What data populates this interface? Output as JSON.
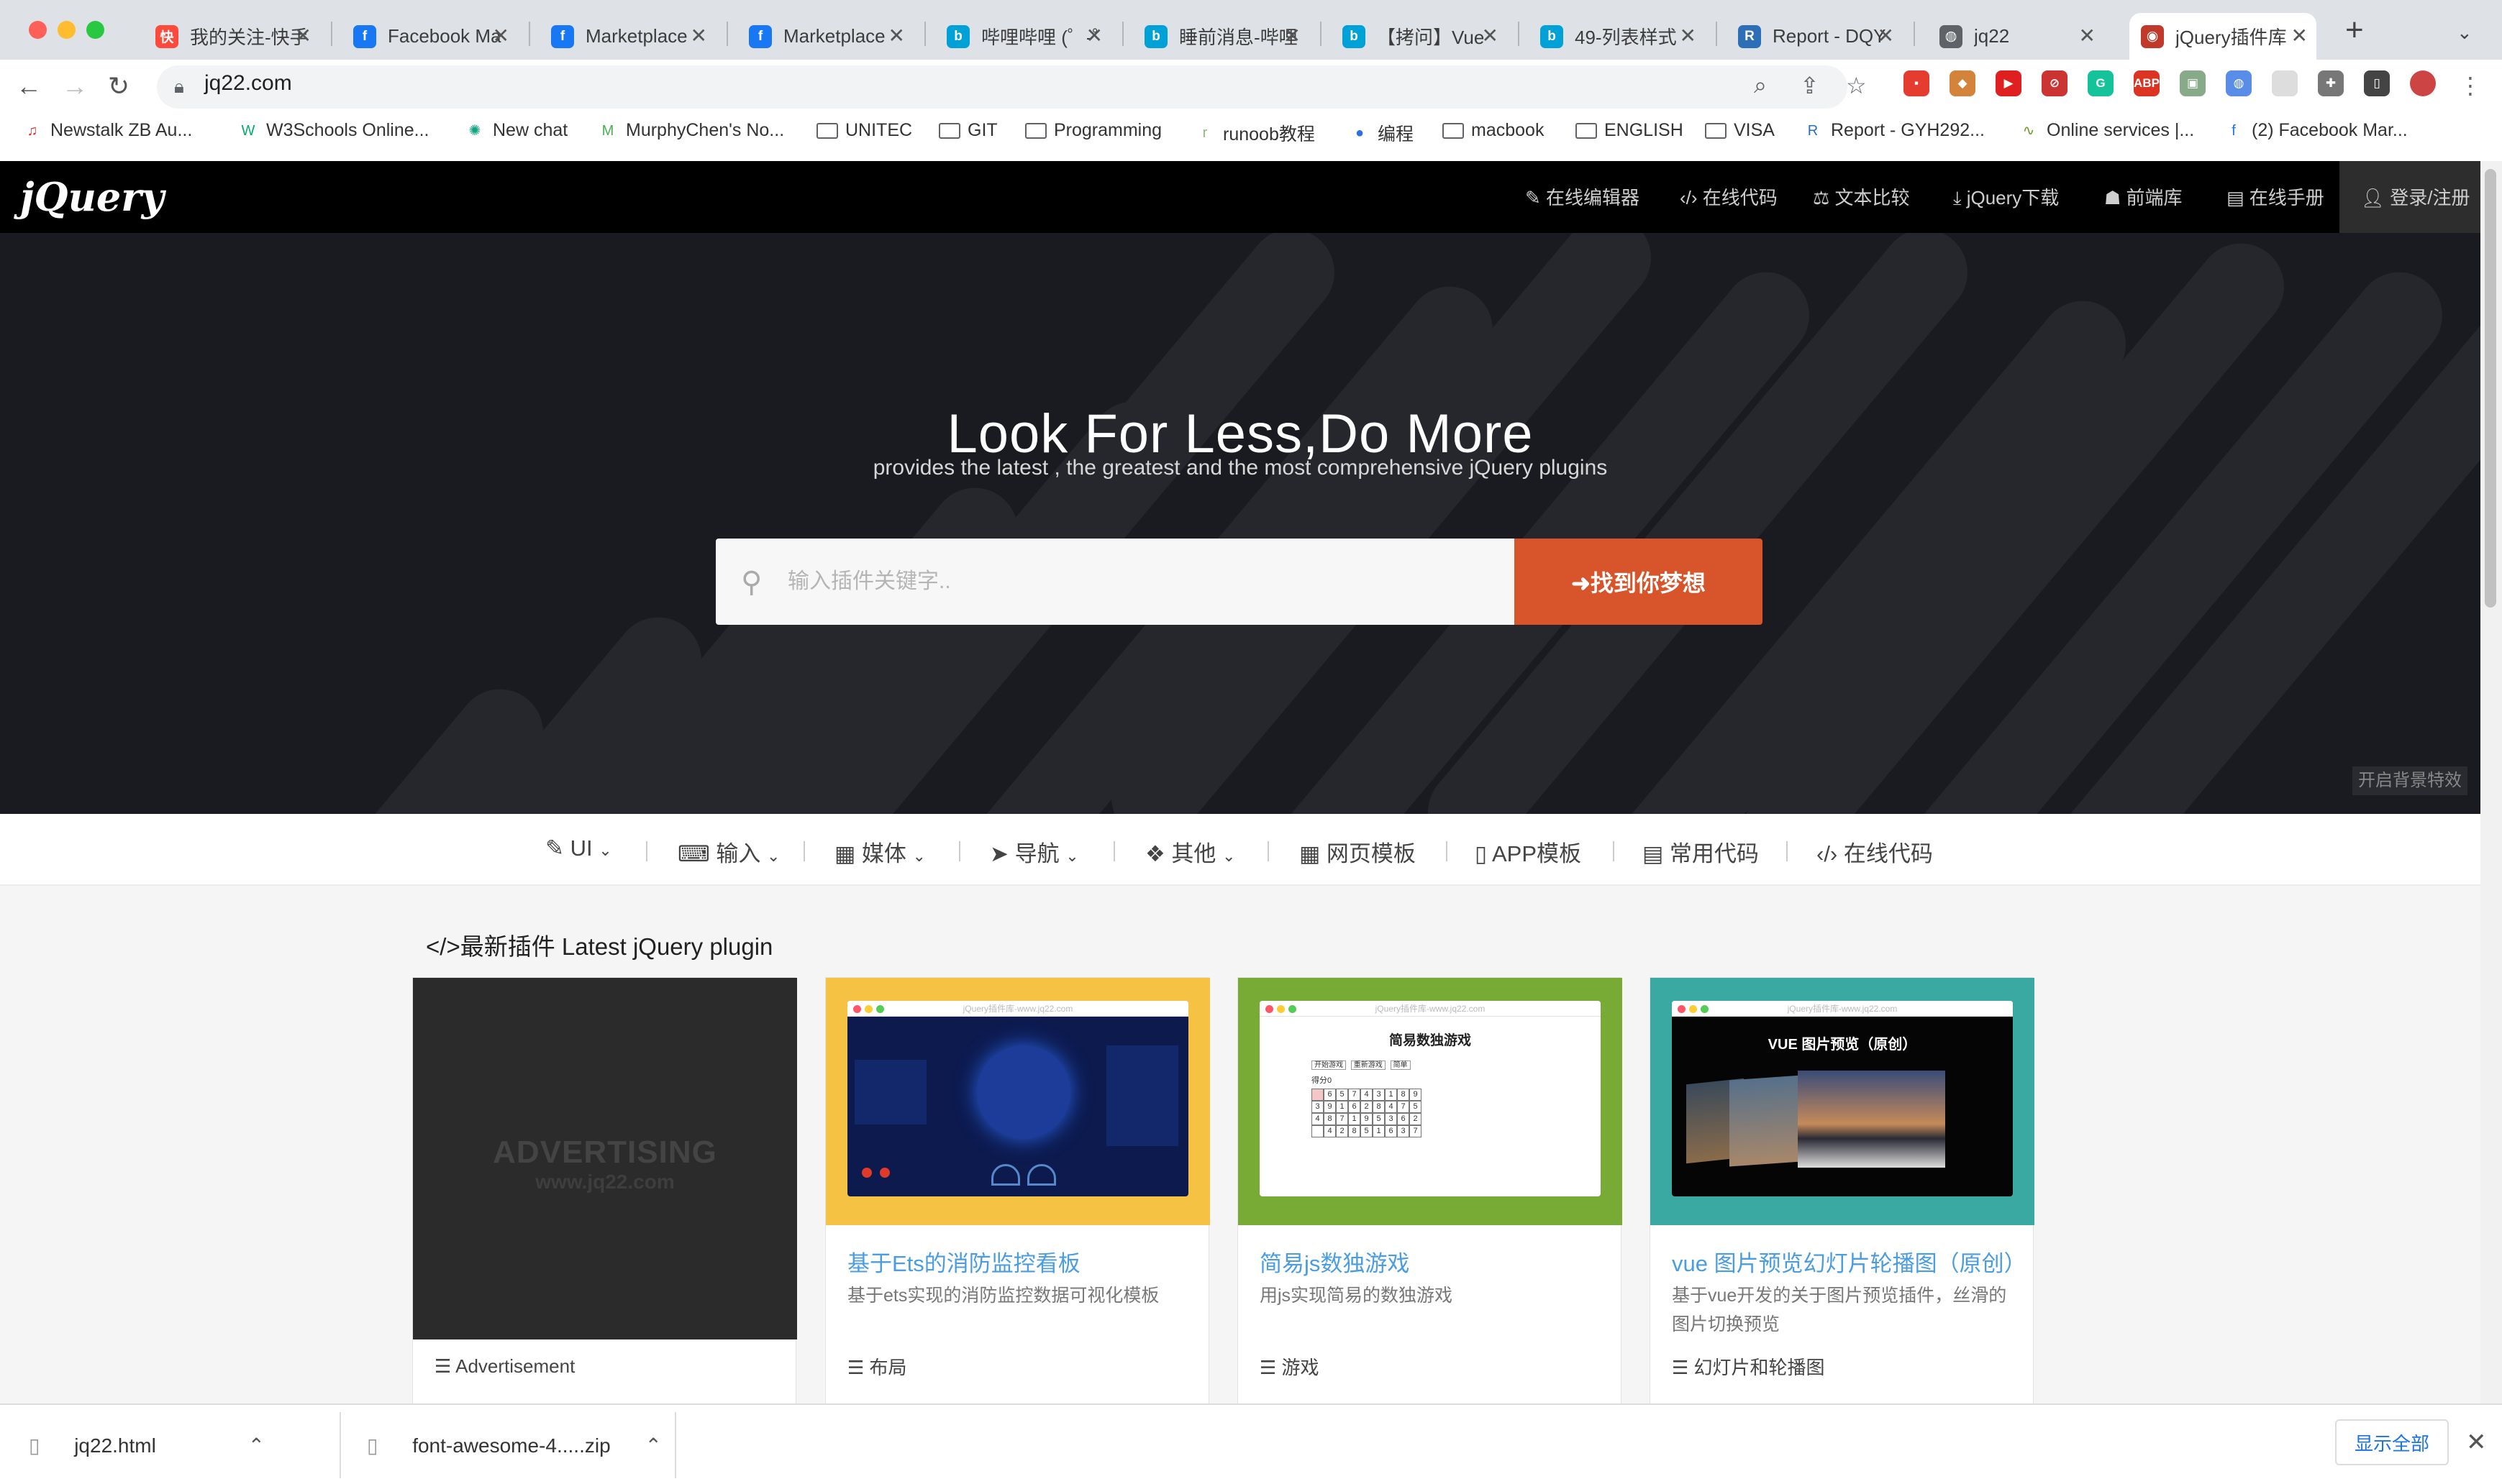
{
  "browser": {
    "tabs": [
      {
        "title": "我的关注-快手",
        "icon": "kuaishou-icon",
        "color": "#fe4a3c",
        "glyph": "快"
      },
      {
        "title": "Facebook Ma",
        "icon": "facebook-icon",
        "color": "#1877f2",
        "glyph": "f"
      },
      {
        "title": "Marketplace",
        "icon": "facebook-icon",
        "color": "#1877f2",
        "glyph": "f"
      },
      {
        "title": "Marketplace",
        "icon": "facebook-icon",
        "color": "#1877f2",
        "glyph": "f"
      },
      {
        "title": "哔哩哔哩 (゜-゜",
        "icon": "bilibili-icon",
        "color": "#00a1d6",
        "glyph": "b"
      },
      {
        "title": "睡前消息-哔哩",
        "icon": "bilibili-icon",
        "color": "#00a1d6",
        "glyph": "b"
      },
      {
        "title": "【拷问】Vue",
        "icon": "bilibili-icon",
        "color": "#00a1d6",
        "glyph": "b"
      },
      {
        "title": "49-列表样式",
        "icon": "bilibili-icon",
        "color": "#00a1d6",
        "glyph": "b"
      },
      {
        "title": "Report - DQY",
        "icon": "report-icon",
        "color": "#2c6fb7",
        "glyph": "R"
      },
      {
        "title": "jq22",
        "icon": "globe-icon",
        "color": "#5f6368",
        "glyph": "◍"
      },
      {
        "title": "jQuery插件库",
        "icon": "jq22-icon",
        "color": "#c0392b",
        "glyph": "◉"
      }
    ],
    "url": "jq22.com",
    "bookmarks": [
      {
        "label": "Newstalk ZB Au...",
        "icon": "radio-icon"
      },
      {
        "label": "W3Schools Online...",
        "icon": "w3schools-icon"
      },
      {
        "label": "New chat",
        "icon": "openai-icon"
      },
      {
        "label": "MurphyChen's No...",
        "icon": "notion-icon"
      },
      {
        "label": "UNITEC",
        "icon": "folder-icon"
      },
      {
        "label": "GIT",
        "icon": "folder-icon"
      },
      {
        "label": "Programming",
        "icon": "folder-icon"
      },
      {
        "label": "runoob教程",
        "icon": "runoob-icon"
      },
      {
        "label": "编程",
        "icon": "blue-circle-icon"
      },
      {
        "label": "macbook",
        "icon": "folder-icon"
      },
      {
        "label": "ENGLISH",
        "icon": "folder-icon"
      },
      {
        "label": "VISA",
        "icon": "folder-icon"
      },
      {
        "label": "Report - GYH292...",
        "icon": "report-icon"
      },
      {
        "label": "Online services |...",
        "icon": "services-icon"
      },
      {
        "label": "(2) Facebook Mar...",
        "icon": "facebook-icon"
      }
    ]
  },
  "site": {
    "nav": [
      "在线编辑器",
      "在线代码",
      "文本比较",
      "jQuery下载",
      "前端库",
      "在线手册"
    ],
    "login": "登录/注册",
    "hero_title": "Look For Less,Do More",
    "hero_subtitle": "provides the latest , the greatest and the most comprehensive jQuery plugins",
    "search_placeholder": "输入插件关键字..",
    "search_button": "找到你梦想",
    "effects_toggle": "开启背景特效",
    "categories": [
      "UI",
      "输入",
      "媒体",
      "导航",
      "其他",
      "网页模板",
      "APP模板",
      "常用代码",
      "在线代码"
    ],
    "section_title": "最新插件 Latest jQuery plugin",
    "ad": {
      "big": "ADVERTISING",
      "small": "www.jq22.com",
      "label": "Advertisement"
    },
    "cards": [
      {
        "title": "基于Ets的消防监控看板",
        "desc": "基于ets实现的消防监控数据可视化模板",
        "tag": "布局",
        "bg": "#f6c244"
      },
      {
        "title": "简易js数独游戏",
        "desc": "用js实现简易的数独游戏",
        "tag": "游戏",
        "bg": "#78ab36",
        "shot_title": "简易数独游戏",
        "shot_buttons": [
          "开始游戏",
          "重新游戏",
          "简单"
        ],
        "shot_score": "得分0",
        "grid": [
          [
            "",
            "6",
            "5",
            "7",
            "4",
            "3",
            "1",
            "8",
            "9"
          ],
          [
            "3",
            "9",
            "1",
            "6",
            "2",
            "8",
            "4",
            "7",
            "5"
          ],
          [
            "4",
            "8",
            "7",
            "1",
            "9",
            "5",
            "3",
            "6",
            "2"
          ],
          [
            "",
            "4",
            "2",
            "8",
            "5",
            "1",
            "6",
            "3",
            "7"
          ]
        ]
      },
      {
        "title": "vue 图片预览幻灯片轮播图（原创）",
        "desc": "基于vue开发的关于图片预览插件，丝滑的图片切换预览",
        "tag": "幻灯片和轮播图",
        "bg": "#3aa9a2",
        "shot_title": "VUE 图片预览（原创）"
      }
    ],
    "shot_header": "jQuery插件库-www.jq22.com"
  },
  "downloads": [
    {
      "name": "jq22.html"
    },
    {
      "name": "font-awesome-4.....zip"
    }
  ],
  "show_all": "显示全部"
}
